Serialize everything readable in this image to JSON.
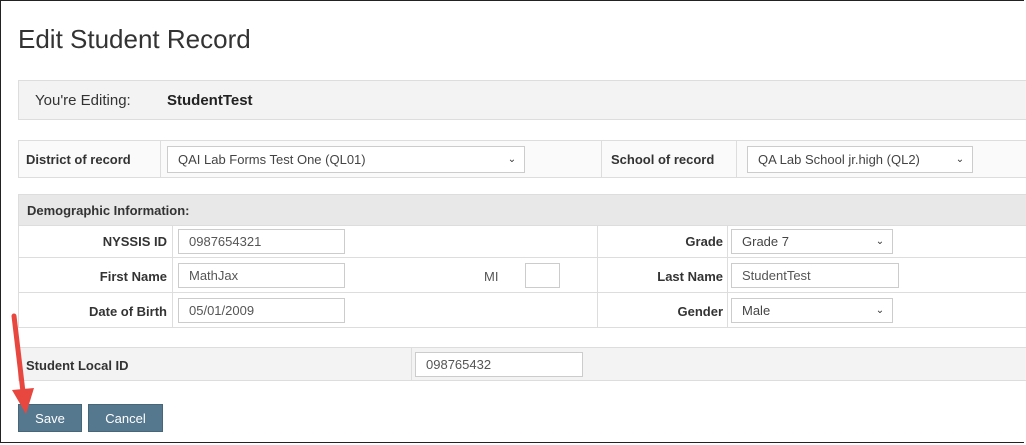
{
  "page": {
    "title": "Edit Student Record"
  },
  "editing": {
    "label": "You're Editing:",
    "student": "StudentTest"
  },
  "record": {
    "district_label": "District of record",
    "district_value": "QAI Lab Forms Test One (QL01)",
    "school_label": "School of record",
    "school_value": "QA Lab School jr.high (QL2)"
  },
  "demographic": {
    "header": "Demographic Information:",
    "nyssis_label": "NYSSIS ID",
    "nyssis_value": "0987654321",
    "grade_label": "Grade",
    "grade_value": "Grade 7",
    "first_name_label": "First Name",
    "first_name_value": "MathJax",
    "mi_label": "MI",
    "mi_value": "",
    "last_name_label": "Last Name",
    "last_name_value": "StudentTest",
    "dob_label": "Date of Birth",
    "dob_value": "05/01/2009",
    "gender_label": "Gender",
    "gender_value": "Male"
  },
  "local_id": {
    "label": "Student Local ID",
    "value": "098765432"
  },
  "actions": {
    "save": "Save",
    "cancel": "Cancel"
  },
  "colors": {
    "button": "#55788f",
    "annotation_arrow": "#e8473f"
  }
}
